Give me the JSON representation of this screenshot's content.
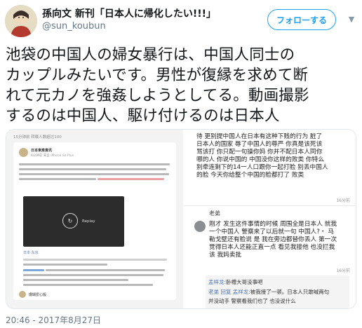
{
  "user": {
    "display_name": "孫向文 新刊「日本人に帰化したい!!!」",
    "handle": "@sun_koubun"
  },
  "follow_button": "フォローする",
  "tweet_lines": [
    "池袋の中国人の婦女暴行は、中国人同士の",
    "カップルみたいです。男性が復縁を求めて断",
    "れて元カノを強姦しようとしてる。動画撮影",
    "するのは中国人、駆け付けるのは日本人"
  ],
  "left_screenshot": {
    "status_top": "15分钟前 转载人数超过100",
    "account_name": "日本東斎資讯",
    "account_sub": "6分钟前 来自 iPhone Se Plus",
    "video_label": "Replay",
    "location": "日本·东京",
    "bottom_account": "珊瑚爱心般"
  },
  "right_screenshot": {
    "top_lines": [
      "待 更别提中国人在日本有这种下贱的行为 脏了",
      "日本人的国家 辱了中国人的尊严 你真是该死该",
      "骂该打 你只配一句操你妈 你并不配日本人同你",
      "哪的人 你说中国的 中国没你这样的败类 你特么",
      "别牵连剩下的14一人口跟你一起打脸 别丢中国人",
      "的脸 今天你给整个中国的脸都打了 败类"
    ],
    "time_1": "16分前",
    "commenter": "老弟",
    "comment_lines": [
      "刚才 发生这件事情的时候 周围全是日本人 就我",
      "一个中国人 警察来了以后就一句 中国人?・ 马",
      "勒戈壁还有脸说 是 我在旁边都替你丢人 第一次",
      "觉得日本人还能正直一点 看见我接他 也没拦我",
      "该 我妈卖批"
    ],
    "time_2": "16分前",
    "quote_lines": [
      {
        "user": "孟祥龙:",
        "text": "卧槽大哥没事吧"
      },
      {
        "user": "老弟 回复 孟祥龙:",
        "text": "被我接了一顿。日本人只敢喊两句"
      },
      {
        "user": "",
        "text": "并没动手 警察看我们也了 也没说什么"
      }
    ]
  },
  "timestamp": "20:46 - 2017年8月27日"
}
